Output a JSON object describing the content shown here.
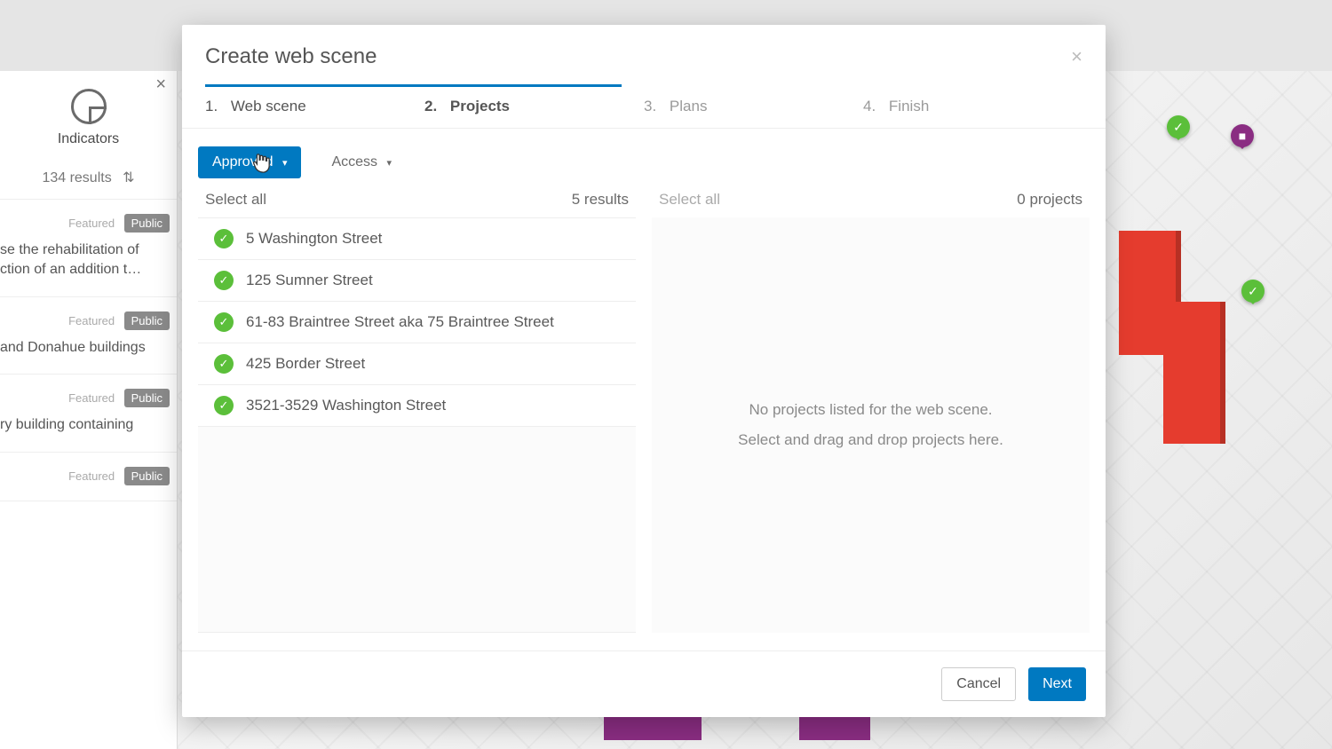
{
  "sidebar": {
    "indicators_label": "Indicators",
    "results_count": "134 results",
    "badges": {
      "featured": "Featured",
      "public": "Public"
    },
    "card1_text": "se the rehabilitation of ction of an addition t…",
    "card2_text": "and Donahue buildings",
    "card3_text": "ry building containing"
  },
  "modal": {
    "title": "Create web scene",
    "steps": [
      {
        "num": "1.",
        "label": "Web scene"
      },
      {
        "num": "2.",
        "label": "Projects"
      },
      {
        "num": "3.",
        "label": "Plans"
      },
      {
        "num": "4.",
        "label": "Finish"
      }
    ],
    "filters": {
      "approved_label": "Approved",
      "access_label": "Access"
    },
    "left": {
      "select_all": "Select all",
      "results": "5 results",
      "items": [
        "5 Washington Street",
        "125 Sumner Street",
        "61-83 Braintree Street aka 75 Braintree Street",
        "425 Border Street",
        "3521-3529 Washington Street"
      ]
    },
    "right": {
      "select_all": "Select all",
      "count": "0 projects",
      "empty_line1": "No projects listed for the web scene.",
      "empty_line2": "Select and drag and drop projects here."
    },
    "footer": {
      "cancel": "Cancel",
      "next": "Next"
    }
  }
}
